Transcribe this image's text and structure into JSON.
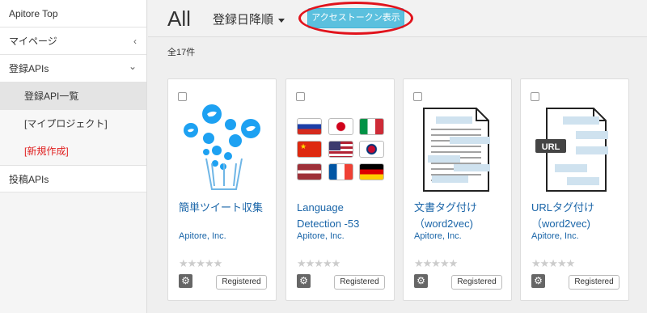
{
  "sidebar": {
    "top": "Apitore Top",
    "mypage": "マイページ",
    "mypage_chev": "‹",
    "registered": "登録APIs",
    "registered_chev": "⌄",
    "subitems": [
      "登録API一覧",
      "[マイプロジェクト]",
      "[新規作成]"
    ],
    "posted": "投稿APIs"
  },
  "header": {
    "title": "All",
    "sort_label": "登録日降順",
    "token_button": "アクセストークン表示"
  },
  "count_label": "全17件",
  "cards": [
    {
      "name": "簡単ツイート収集",
      "vendor": "Apitore, Inc.",
      "badge": "Registered",
      "image_icon": "twitter-cup-icon"
    },
    {
      "name": "Language Detection -53",
      "vendor": "Apitore, Inc.",
      "badge": "Registered",
      "image_icon": "flags-icon"
    },
    {
      "name": "文書タグ付け（word2vec)",
      "vendor": "Apitore, Inc.",
      "badge": "Registered",
      "image_icon": "document-tags-icon"
    },
    {
      "name": "URLタグ付け（word2vec)",
      "vendor": "Apitore, Inc.",
      "badge": "Registered",
      "image_icon": "url-tags-icon"
    }
  ],
  "url_badge": "URL",
  "colors": {
    "accent": "#5bc0de",
    "link": "#1a65a8",
    "highlight": "#e1131c",
    "twitter": "#1da1f2"
  }
}
